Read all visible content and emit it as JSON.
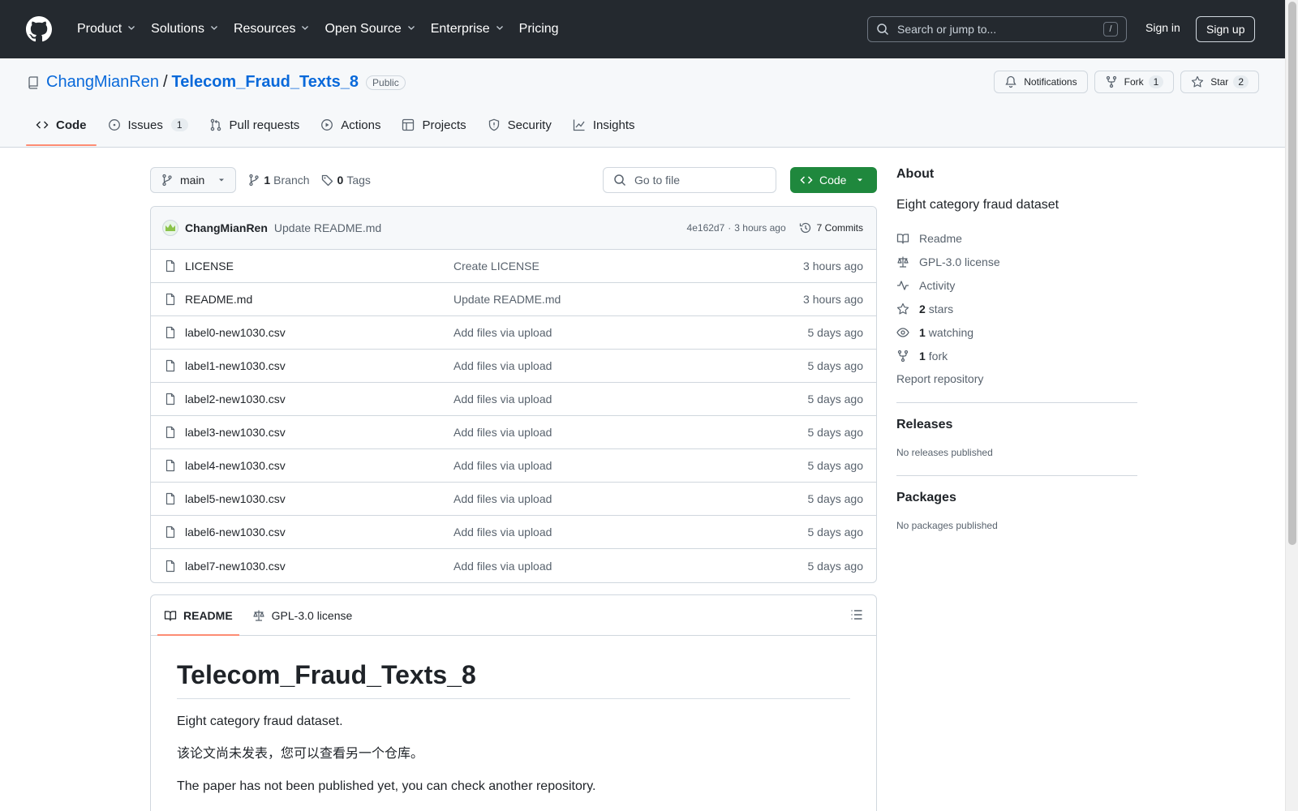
{
  "header": {
    "nav": [
      "Product",
      "Solutions",
      "Resources",
      "Open Source",
      "Enterprise",
      "Pricing"
    ],
    "search_placeholder": "Search or jump to...",
    "search_shortcut": "/",
    "signin": "Sign in",
    "signup": "Sign up"
  },
  "repo": {
    "owner": "ChangMianRen",
    "sep": "/",
    "name": "Telecom_Fraud_Texts_8",
    "visibility": "Public",
    "notifications_label": "Notifications",
    "fork_label": "Fork",
    "fork_count": "1",
    "star_label": "Star",
    "star_count": "2",
    "tabs": {
      "code": "Code",
      "issues": "Issues",
      "issues_count": "1",
      "pulls": "Pull requests",
      "actions": "Actions",
      "projects": "Projects",
      "security": "Security",
      "insights": "Insights"
    }
  },
  "toolbar": {
    "branch": "main",
    "branch_count": "1",
    "branch_label": "Branch",
    "tag_count": "0",
    "tag_label": "Tags",
    "goto_placeholder": "Go to file",
    "code_button": "Code"
  },
  "commit": {
    "author": "ChangMianRen",
    "message": "Update README.md",
    "hash": "4e162d7",
    "sep": "·",
    "time": "3 hours ago",
    "commits_label": "7 Commits"
  },
  "files": [
    {
      "name": "LICENSE",
      "message": "Create LICENSE",
      "time": "3 hours ago"
    },
    {
      "name": "README.md",
      "message": "Update README.md",
      "time": "3 hours ago"
    },
    {
      "name": "label0-new1030.csv",
      "message": "Add files via upload",
      "time": "5 days ago"
    },
    {
      "name": "label1-new1030.csv",
      "message": "Add files via upload",
      "time": "5 days ago"
    },
    {
      "name": "label2-new1030.csv",
      "message": "Add files via upload",
      "time": "5 days ago"
    },
    {
      "name": "label3-new1030.csv",
      "message": "Add files via upload",
      "time": "5 days ago"
    },
    {
      "name": "label4-new1030.csv",
      "message": "Add files via upload",
      "time": "5 days ago"
    },
    {
      "name": "label5-new1030.csv",
      "message": "Add files via upload",
      "time": "5 days ago"
    },
    {
      "name": "label6-new1030.csv",
      "message": "Add files via upload",
      "time": "5 days ago"
    },
    {
      "name": "label7-new1030.csv",
      "message": "Add files via upload",
      "time": "5 days ago"
    }
  ],
  "readme": {
    "tab_readme": "README",
    "tab_license": "GPL-3.0 license",
    "title": "Telecom_Fraud_Texts_8",
    "p1": "Eight category fraud dataset.",
    "p2": "该论文尚未发表，您可以查看另一个仓库。",
    "p3": "The paper has not been published yet, you can check another repository."
  },
  "sidebar": {
    "about_title": "About",
    "description": "Eight category fraud dataset",
    "readme": "Readme",
    "license": "GPL-3.0 license",
    "activity": "Activity",
    "stars_count": "2",
    "stars_label": "stars",
    "watching_count": "1",
    "watching_label": "watching",
    "forks_count": "1",
    "forks_label": "fork",
    "report": "Report repository",
    "releases_title": "Releases",
    "releases_empty": "No releases published",
    "packages_title": "Packages",
    "packages_empty": "No packages published"
  },
  "colors": {
    "header_bg": "#24292f",
    "link": "#0969da",
    "green": "#1f883d",
    "tab_underline": "#fd8c73"
  }
}
